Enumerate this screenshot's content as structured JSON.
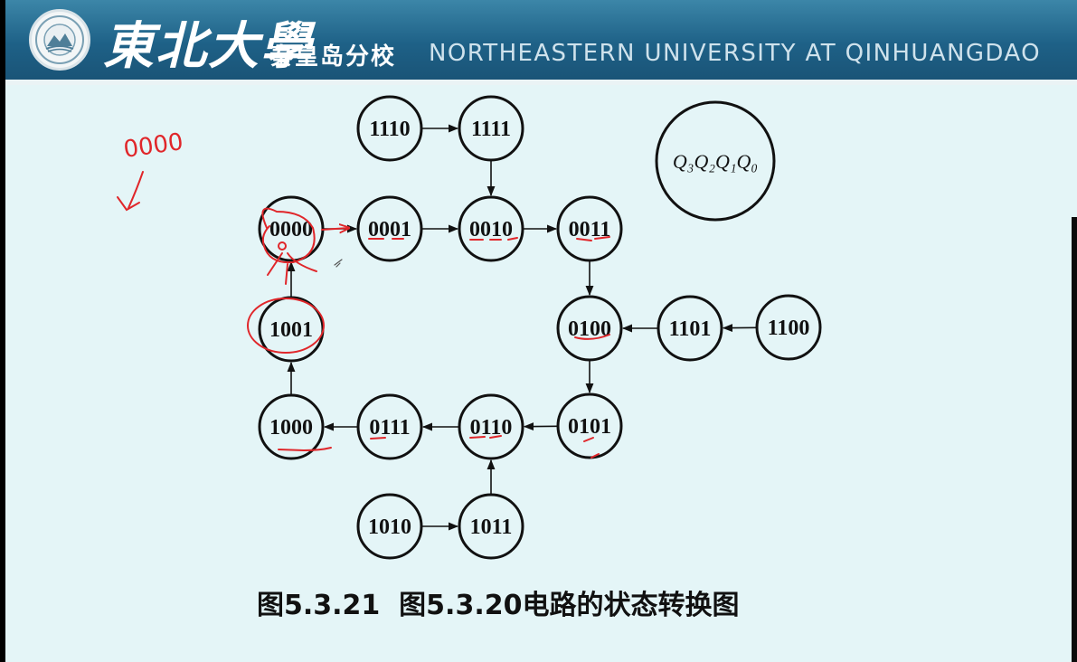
{
  "header": {
    "university_cn": "東北大學",
    "campus_cn": "秦皇岛分校",
    "university_en": "NORTHEASTERN UNIVERSITY  AT  QINHUANGDAO"
  },
  "diagram": {
    "states": [
      {
        "id": "s1110",
        "label": "1110"
      },
      {
        "id": "s1111",
        "label": "1111"
      },
      {
        "id": "s0000",
        "label": "0000"
      },
      {
        "id": "s0001",
        "label": "0001"
      },
      {
        "id": "s0010",
        "label": "0010"
      },
      {
        "id": "s0011",
        "label": "0011"
      },
      {
        "id": "s0100",
        "label": "0100"
      },
      {
        "id": "s1101",
        "label": "1101"
      },
      {
        "id": "s1100",
        "label": "1100"
      },
      {
        "id": "s1001",
        "label": "1001"
      },
      {
        "id": "s0101",
        "label": "0101"
      },
      {
        "id": "s0110",
        "label": "0110"
      },
      {
        "id": "s0111",
        "label": "0111"
      },
      {
        "id": "s1000",
        "label": "1000"
      },
      {
        "id": "s1010",
        "label": "1010"
      },
      {
        "id": "s1011",
        "label": "1011"
      }
    ],
    "edges": [
      [
        "s1110",
        "s1111"
      ],
      [
        "s1111",
        "s0010"
      ],
      [
        "s0000",
        "s0001"
      ],
      [
        "s0001",
        "s0010"
      ],
      [
        "s0010",
        "s0011"
      ],
      [
        "s0011",
        "s0100"
      ],
      [
        "s1100",
        "s1101"
      ],
      [
        "s1101",
        "s0100"
      ],
      [
        "s0100",
        "s0101"
      ],
      [
        "s0101",
        "s0110"
      ],
      [
        "s0110",
        "s0111"
      ],
      [
        "s0111",
        "s1000"
      ],
      [
        "s1000",
        "s1001"
      ],
      [
        "s1001",
        "s0000"
      ],
      [
        "s1010",
        "s1011"
      ],
      [
        "s1011",
        "s0110"
      ]
    ],
    "legend": "Q₃Q₂Q₁Q₀"
  },
  "annotations": {
    "handwritten_note": "0000"
  },
  "caption": "图5.3.21  图5.3.20电路的状态转换图"
}
